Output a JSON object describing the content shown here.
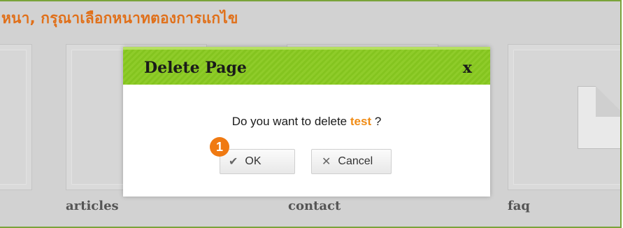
{
  "header": {
    "title": "หนา, กรุณาเลือกหนาทตองการแกไข"
  },
  "pages": [
    {
      "label": "articles"
    },
    {
      "label": "contact"
    },
    {
      "label": "faq"
    }
  ],
  "dialog": {
    "title": "Delete Page",
    "close_label": "x",
    "message_prefix": "Do you want to delete ",
    "page_name": "test",
    "message_suffix": " ?",
    "ok_label": "OK",
    "cancel_label": "Cancel",
    "ok_icon": "check-icon",
    "cancel_icon": "x-icon"
  },
  "annotation": {
    "step_number": "1"
  },
  "colors": {
    "accent_green": "#8fcc2a",
    "accent_orange": "#f08c16",
    "frame_green": "#7aa33a"
  }
}
